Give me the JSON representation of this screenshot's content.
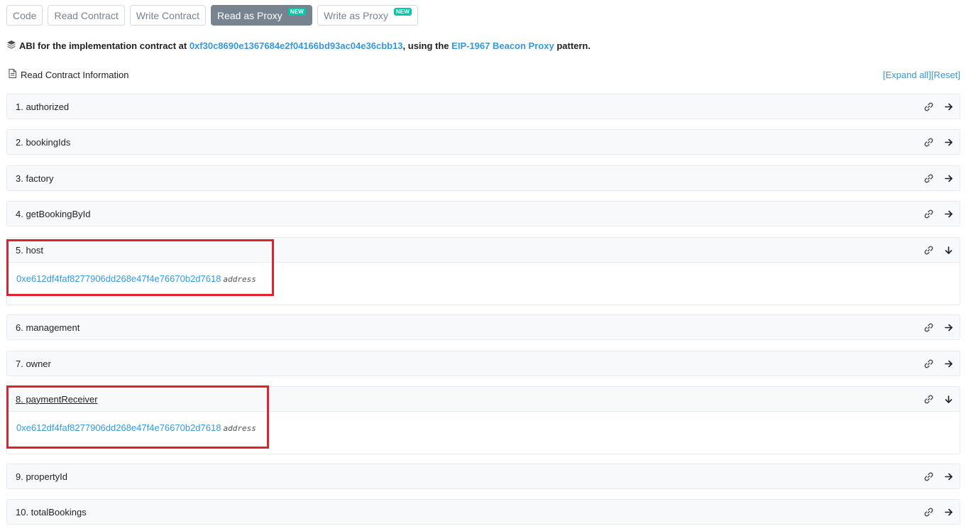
{
  "tabs": [
    {
      "label": "Code",
      "badge": ""
    },
    {
      "label": "Read Contract",
      "badge": ""
    },
    {
      "label": "Write Contract",
      "badge": ""
    },
    {
      "label": "Read as Proxy",
      "badge": "NEW"
    },
    {
      "label": "Write as Proxy",
      "badge": "NEW"
    }
  ],
  "active_tab": "Read as Proxy",
  "abi": {
    "prefix": "ABI for the implementation contract at ",
    "contract_address": "0xf30c8690e1367684e2f04166bd93ac04e36cbb13",
    "middle": ", using the ",
    "pattern_link": "EIP-1967 Beacon Proxy",
    "suffix": " pattern."
  },
  "read_info": {
    "title": "Read Contract Information",
    "expand_all": "[Expand all]",
    "reset": "[Reset]"
  },
  "items": [
    {
      "title": "1. authorized"
    },
    {
      "title": "2. bookingIds"
    },
    {
      "title": "3. factory"
    },
    {
      "title": "4. getBookingById"
    },
    {
      "title": "5. host",
      "value": "0xe612df4faf8277906dd268e47f4e76670b2d7618",
      "type": "address"
    },
    {
      "title": "6. management"
    },
    {
      "title": "7. owner"
    },
    {
      "title": "8. paymentReceiver",
      "value": "0xe612df4faf8277906dd268e47f4e76670b2d7618",
      "type": "address"
    },
    {
      "title": "9. propertyId"
    },
    {
      "title": "10. totalBookings"
    }
  ],
  "colors": {
    "accent": "#3498db",
    "active_tab": "#77838f",
    "badge": "#00c9a7",
    "highlight": "#e3202d"
  }
}
